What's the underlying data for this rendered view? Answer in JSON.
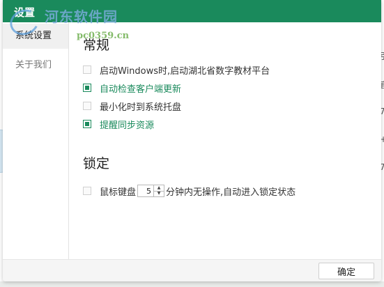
{
  "window": {
    "title": "设置"
  },
  "watermark": {
    "main": "河东软件园",
    "sub": "pc0359.cn"
  },
  "sidebar": {
    "items": [
      {
        "label": "系统设置",
        "active": true
      },
      {
        "label": "关于我们",
        "active": false
      }
    ]
  },
  "general": {
    "title": "常规",
    "options": [
      {
        "label": "启动Windows时,启动湖北省数字教材平台",
        "checked": false
      },
      {
        "label": "自动检查客户端更新",
        "checked": true
      },
      {
        "label": "最小化时到系统托盘",
        "checked": false
      },
      {
        "label": "提醒同步资源",
        "checked": true
      }
    ]
  },
  "lock": {
    "title": "锁定",
    "checked": false,
    "prefix": "鼠标键盘",
    "minutes": "5",
    "suffix": "分钟内无操作,自动进入锁定状态"
  },
  "footer": {
    "ok_label": "确定"
  },
  "background": {
    "right_fragments": [
      "引",
      "官",
      "7",
      "+",
      "7"
    ]
  },
  "colors": {
    "accent": "#1a8a5c",
    "checked_text": "#1a8a5c",
    "unchecked_text": "#333333"
  },
  "icons": {
    "spin_up": "▲",
    "spin_down": "▼"
  }
}
